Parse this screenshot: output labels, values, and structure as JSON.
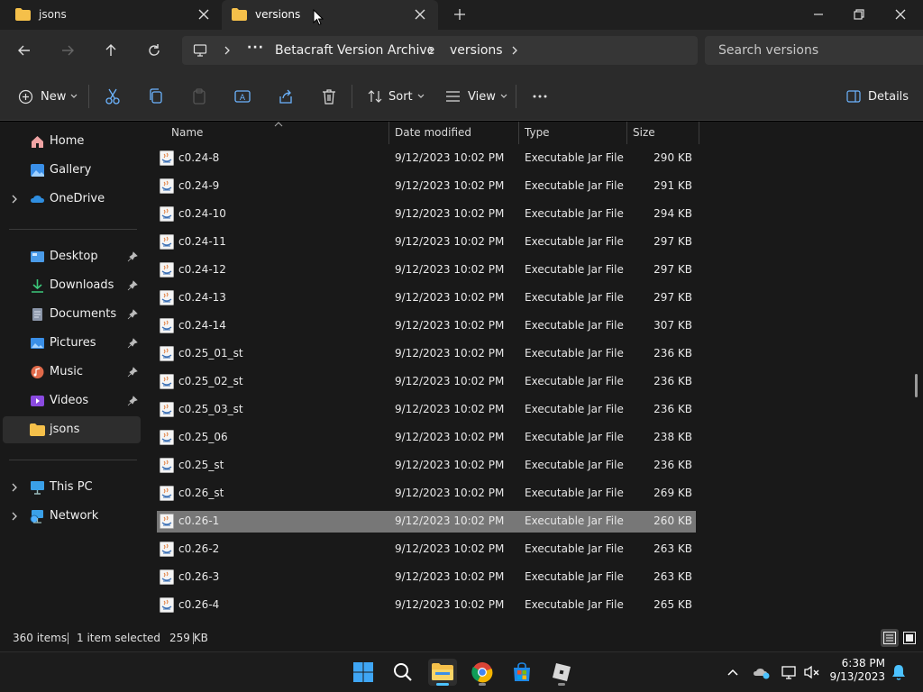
{
  "tabs": [
    {
      "label": "jsons",
      "active": false
    },
    {
      "label": "versions",
      "active": true
    }
  ],
  "breadcrumb": {
    "items": [
      "Betacraft Version Archive",
      "versions"
    ]
  },
  "search": {
    "placeholder": "Search versions"
  },
  "commands": {
    "new_label": "New",
    "sort_label": "Sort",
    "view_label": "View",
    "details_label": "Details"
  },
  "sidebar": {
    "top": [
      {
        "label": "Home",
        "icon": "home-icon"
      },
      {
        "label": "Gallery",
        "icon": "gallery-icon"
      },
      {
        "label": "OneDrive",
        "icon": "cloud-icon"
      }
    ],
    "quick": [
      {
        "label": "Desktop",
        "icon": "desktop-icon"
      },
      {
        "label": "Downloads",
        "icon": "download-icon"
      },
      {
        "label": "Documents",
        "icon": "documents-icon"
      },
      {
        "label": "Pictures",
        "icon": "pictures-icon"
      },
      {
        "label": "Music",
        "icon": "music-icon"
      },
      {
        "label": "Videos",
        "icon": "videos-icon"
      },
      {
        "label": "jsons",
        "icon": "folder-icon"
      }
    ],
    "bottom": [
      {
        "label": "This PC",
        "icon": "computer-icon"
      },
      {
        "label": "Network",
        "icon": "network-icon"
      }
    ]
  },
  "columns": {
    "name": "Name",
    "date": "Date modified",
    "type": "Type",
    "size": "Size"
  },
  "files": [
    {
      "name": "c0.24-8",
      "date": "9/12/2023 10:02 PM",
      "type": "Executable Jar File",
      "size": "290 KB"
    },
    {
      "name": "c0.24-9",
      "date": "9/12/2023 10:02 PM",
      "type": "Executable Jar File",
      "size": "291 KB"
    },
    {
      "name": "c0.24-10",
      "date": "9/12/2023 10:02 PM",
      "type": "Executable Jar File",
      "size": "294 KB"
    },
    {
      "name": "c0.24-11",
      "date": "9/12/2023 10:02 PM",
      "type": "Executable Jar File",
      "size": "297 KB"
    },
    {
      "name": "c0.24-12",
      "date": "9/12/2023 10:02 PM",
      "type": "Executable Jar File",
      "size": "297 KB"
    },
    {
      "name": "c0.24-13",
      "date": "9/12/2023 10:02 PM",
      "type": "Executable Jar File",
      "size": "297 KB"
    },
    {
      "name": "c0.24-14",
      "date": "9/12/2023 10:02 PM",
      "type": "Executable Jar File",
      "size": "307 KB"
    },
    {
      "name": "c0.25_01_st",
      "date": "9/12/2023 10:02 PM",
      "type": "Executable Jar File",
      "size": "236 KB"
    },
    {
      "name": "c0.25_02_st",
      "date": "9/12/2023 10:02 PM",
      "type": "Executable Jar File",
      "size": "236 KB"
    },
    {
      "name": "c0.25_03_st",
      "date": "9/12/2023 10:02 PM",
      "type": "Executable Jar File",
      "size": "236 KB"
    },
    {
      "name": "c0.25_06",
      "date": "9/12/2023 10:02 PM",
      "type": "Executable Jar File",
      "size": "238 KB"
    },
    {
      "name": "c0.25_st",
      "date": "9/12/2023 10:02 PM",
      "type": "Executable Jar File",
      "size": "236 KB"
    },
    {
      "name": "c0.26_st",
      "date": "9/12/2023 10:02 PM",
      "type": "Executable Jar File",
      "size": "269 KB"
    },
    {
      "name": "c0.26-1",
      "date": "9/12/2023 10:02 PM",
      "type": "Executable Jar File",
      "size": "260 KB",
      "selected": true
    },
    {
      "name": "c0.26-2",
      "date": "9/12/2023 10:02 PM",
      "type": "Executable Jar File",
      "size": "263 KB"
    },
    {
      "name": "c0.26-3",
      "date": "9/12/2023 10:02 PM",
      "type": "Executable Jar File",
      "size": "263 KB"
    },
    {
      "name": "c0.26-4",
      "date": "9/12/2023 10:02 PM",
      "type": "Executable Jar File",
      "size": "265 KB"
    }
  ],
  "status": {
    "item_count": "360 items",
    "selection": "1 item selected",
    "selection_size": "259 KB"
  },
  "taskbar": {
    "apps": [
      "windows-start-icon",
      "search-icon",
      "file-explorer-icon",
      "chrome-icon",
      "microsoft-store-icon",
      "roblox-icon"
    ],
    "time": "6:38 PM",
    "date": "9/13/2023"
  },
  "colors": {
    "accent": "#4cc2ff",
    "folder": "#f5c04a",
    "selected_row": "#777777"
  }
}
